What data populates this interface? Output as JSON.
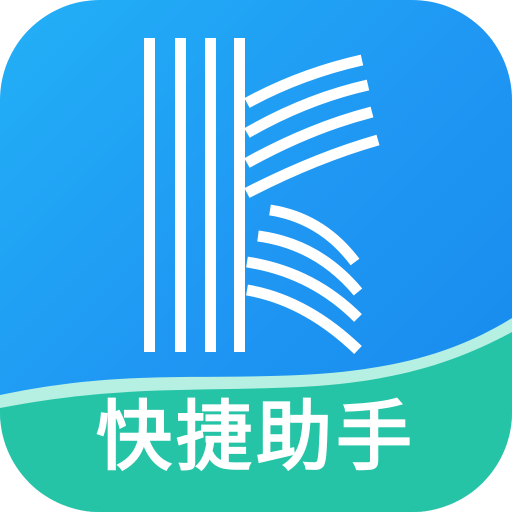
{
  "app": {
    "name": "快捷助手",
    "icon": "letter-k-logo-icon"
  },
  "colors": {
    "background_blue": "#1f97f3",
    "band_teal": "#26c4a6",
    "band_light": "#b6f0e2",
    "text": "#ffffff"
  }
}
